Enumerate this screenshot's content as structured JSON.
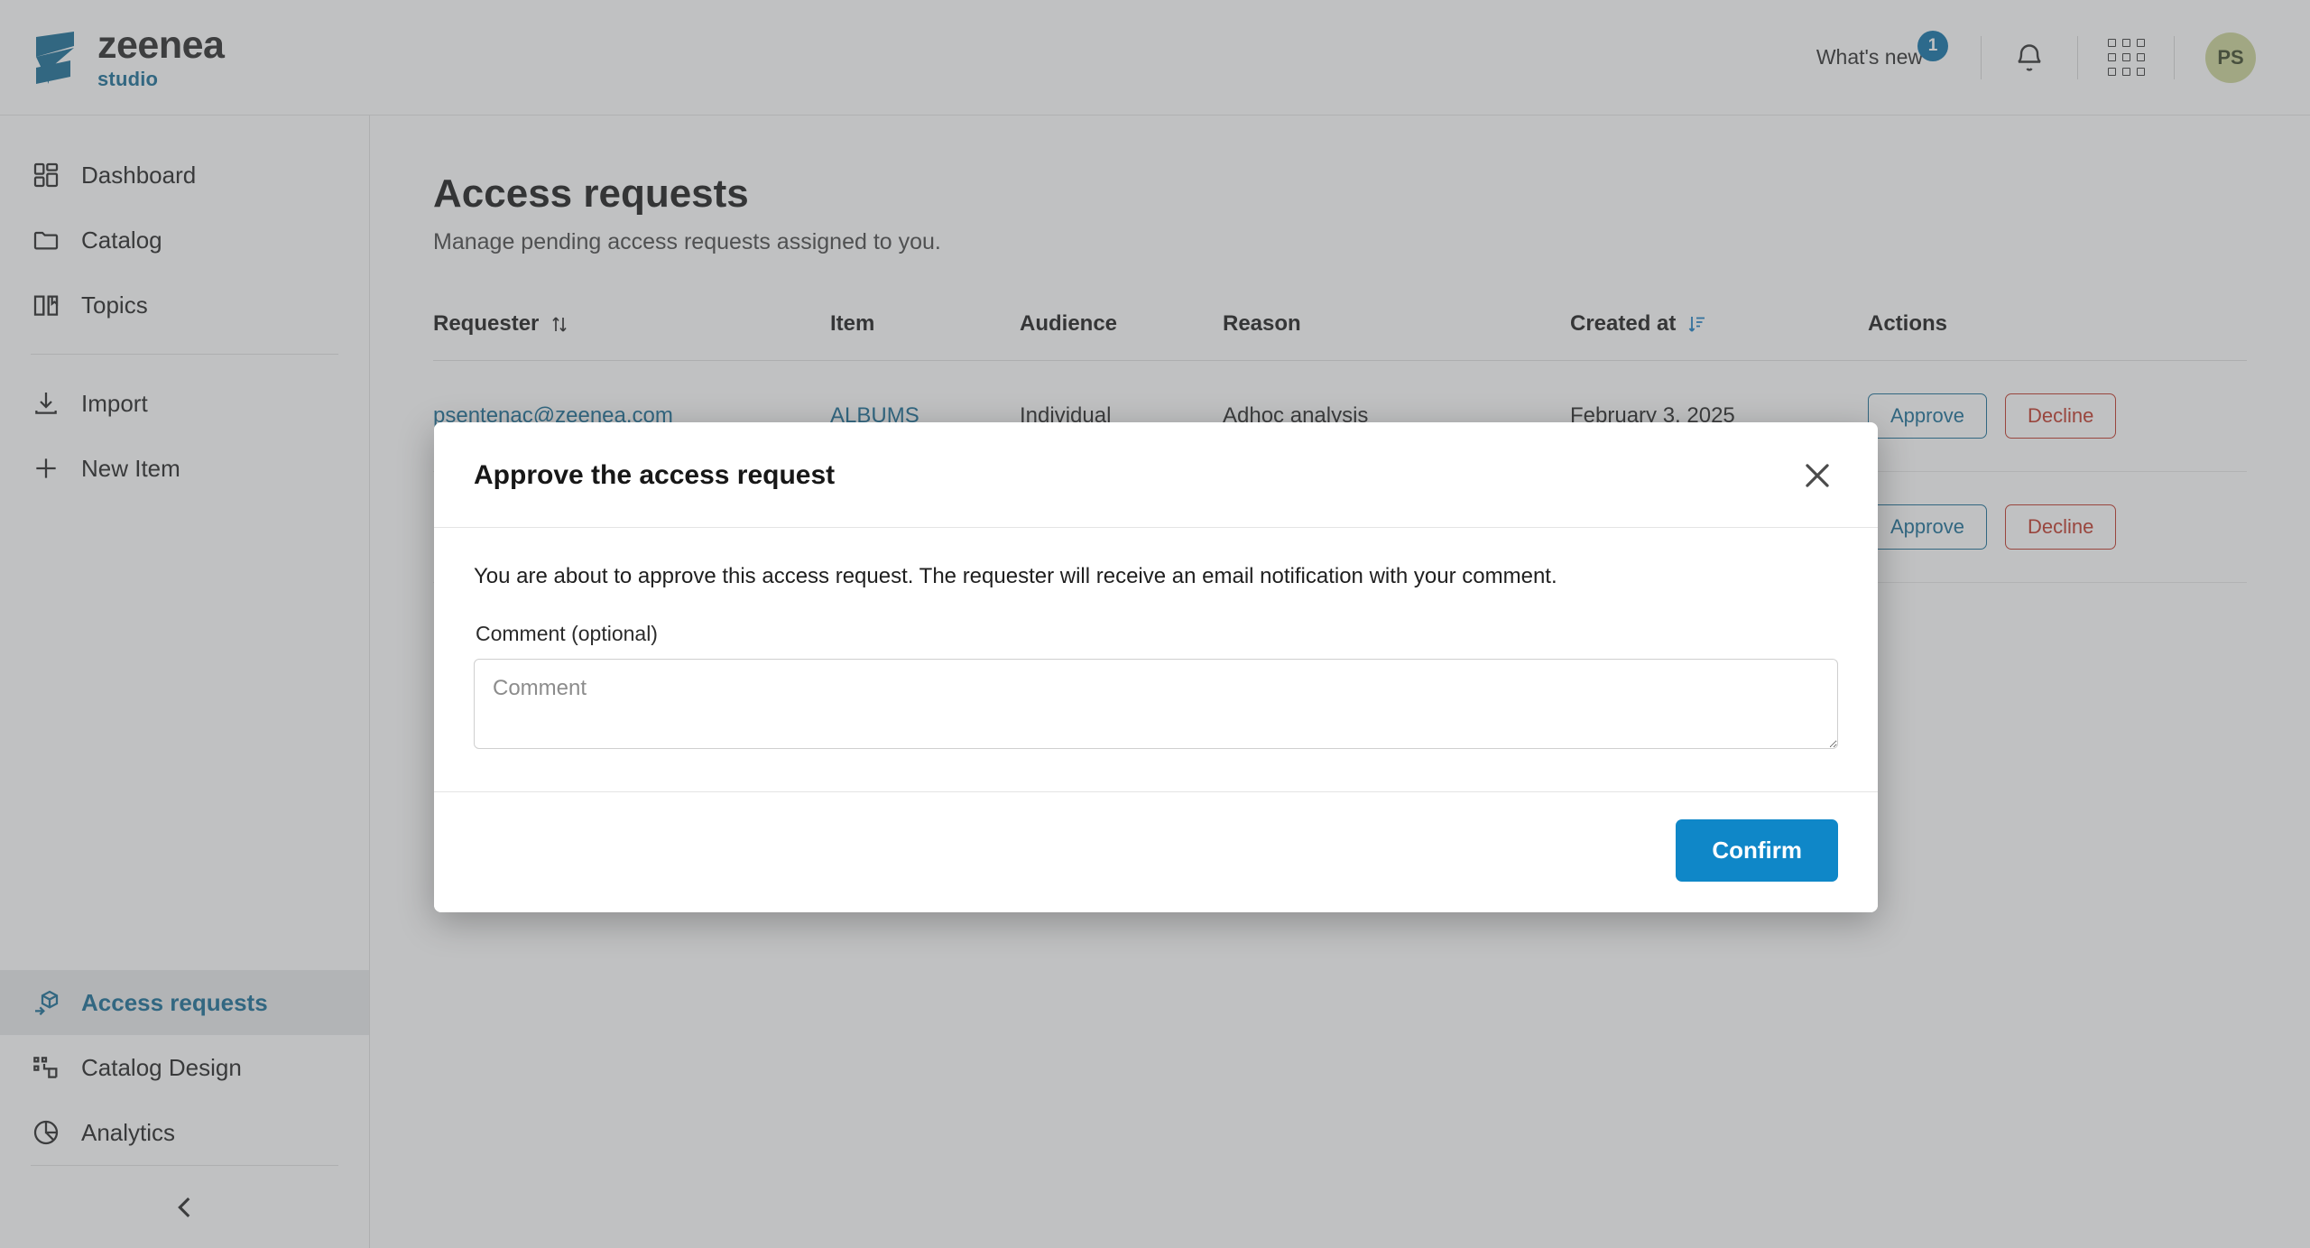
{
  "brand": {
    "name": "zeenea",
    "product": "studio",
    "accent": "#1b6f96",
    "logo_icon": "zeenea-z-logo-icon"
  },
  "topbar": {
    "whats_new_label": "What's new",
    "whats_new_count": "1",
    "badge_color": "#1273a8",
    "notifications_icon": "bell-icon",
    "apps_icon": "apps-grid-icon",
    "avatar_initials": "PS",
    "avatar_color": "#cdd69a"
  },
  "sidebar": {
    "primary_items": [
      {
        "label": "Dashboard",
        "icon": "dashboard-icon",
        "active": false
      },
      {
        "label": "Catalog",
        "icon": "folder-icon",
        "active": false
      },
      {
        "label": "Topics",
        "icon": "book-icon",
        "active": false
      }
    ],
    "secondary_items": [
      {
        "label": "Import",
        "icon": "download-icon",
        "active": false
      },
      {
        "label": "New Item",
        "icon": "plus-icon",
        "active": false
      }
    ],
    "bottom_items": [
      {
        "label": "Access requests",
        "icon": "access-request-icon",
        "active": true
      },
      {
        "label": "Catalog Design",
        "icon": "catalog-design-icon",
        "active": false
      },
      {
        "label": "Analytics",
        "icon": "pie-chart-icon",
        "active": false
      }
    ],
    "collapse_icon": "chevron-left-icon"
  },
  "main": {
    "title": "Access requests",
    "subtitle": "Manage pending access requests assigned to you.",
    "table": {
      "columns": [
        {
          "label": "Requester",
          "sort": "unsorted",
          "sort_icon": "sort-both-icon"
        },
        {
          "label": "Item",
          "sort": "none"
        },
        {
          "label": "Audience",
          "sort": "none"
        },
        {
          "label": "Reason",
          "sort": "none"
        },
        {
          "label": "Created at",
          "sort": "desc",
          "sort_icon": "sort-descending-icon"
        },
        {
          "label": "Actions",
          "sort": "none"
        }
      ],
      "sort_active_color": "#1b7fc4",
      "rows": [
        {
          "requester": "psentenac@zeenea.com",
          "item": "ALBUMS",
          "audience": "Individual",
          "reason": "Adhoc analysis",
          "created_at": "February 3, 2025",
          "approve_label": "Approve",
          "decline_label": "Decline"
        },
        {
          "requester": "",
          "item": "",
          "audience": "",
          "reason": "",
          "created_at": "",
          "approve_label": "Approve",
          "decline_label": "Decline"
        }
      ]
    }
  },
  "modal": {
    "title": "Approve the access request",
    "close_icon": "close-x-icon",
    "description": "You are about to approve this access request. The requester will receive an email notification with your comment.",
    "comment_label": "Comment (optional)",
    "comment_value": "",
    "comment_placeholder": "Comment",
    "confirm_label": "Confirm",
    "confirm_color": "#0f87c8"
  }
}
